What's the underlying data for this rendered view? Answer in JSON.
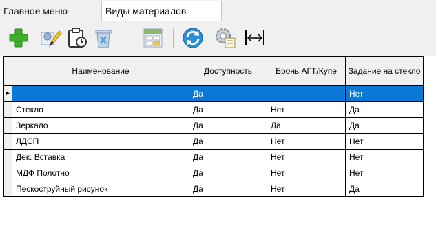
{
  "tabs": [
    {
      "label": "Главное меню",
      "active": false
    },
    {
      "label": "Виды материалов",
      "active": true
    }
  ],
  "toolbar": {
    "buttons": [
      {
        "icon": "add-icon"
      },
      {
        "icon": "edit-icon"
      },
      {
        "icon": "copy-icon"
      },
      {
        "icon": "delete-icon"
      },
      {
        "icon": "excel-export-icon"
      },
      {
        "icon": "refresh-icon"
      },
      {
        "icon": "settings-icon"
      },
      {
        "icon": "fit-columns-icon"
      }
    ]
  },
  "grid": {
    "columns": [
      "Наименование",
      "Доступность",
      "Бронь АГТ/Купе",
      "Задание на стекло"
    ],
    "current_row_marker": "▸",
    "rows": [
      {
        "cells": [
          "",
          "Да",
          "",
          "Нет"
        ],
        "selected": true
      },
      {
        "cells": [
          "Стекло",
          "Да",
          "Нет",
          "Да"
        ],
        "selected": false
      },
      {
        "cells": [
          "Зеркало",
          "Да",
          "Да",
          "Да"
        ],
        "selected": false
      },
      {
        "cells": [
          "ЛДСП",
          "Да",
          "Нет",
          "Нет"
        ],
        "selected": false
      },
      {
        "cells": [
          "Дек. Вставка",
          "Да",
          "Нет",
          "Нет"
        ],
        "selected": false
      },
      {
        "cells": [
          "МДФ Полотно",
          "Да",
          "Нет",
          "Нет"
        ],
        "selected": false
      },
      {
        "cells": [
          "Пескоструйный рисунок",
          "Да",
          "Нет",
          "Да"
        ],
        "selected": false
      }
    ]
  },
  "colors": {
    "selection": "#0a78d7",
    "add_icon": "#3fae29",
    "refresh_icon": "#2a8fd6"
  }
}
